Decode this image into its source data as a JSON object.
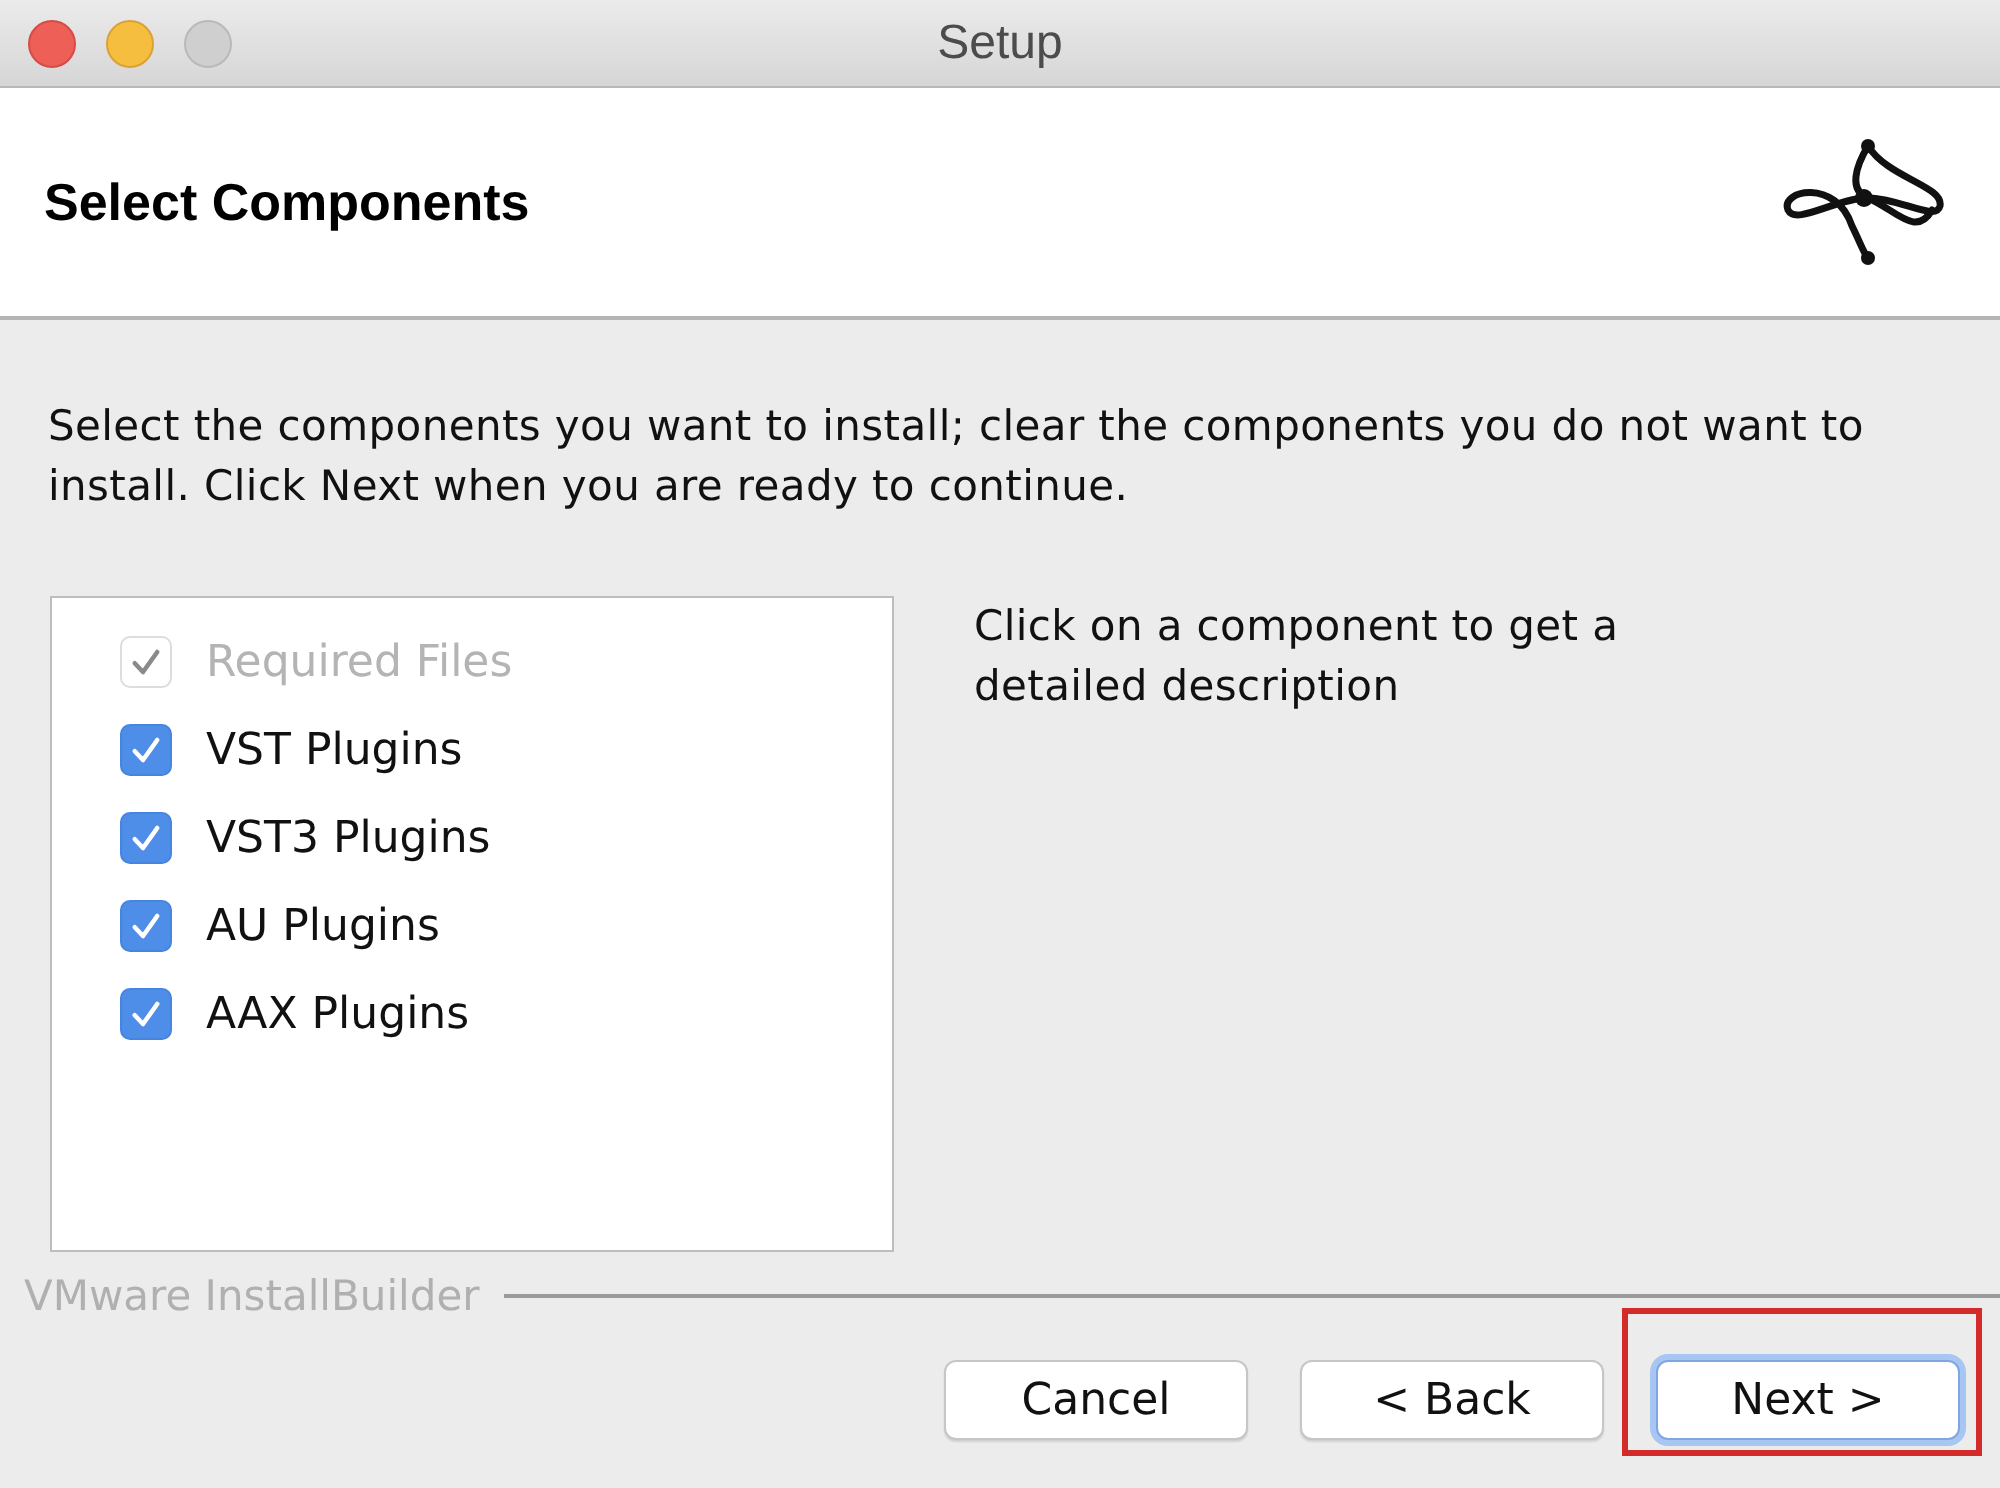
{
  "window": {
    "title": "Setup"
  },
  "header": {
    "title": "Select Components"
  },
  "instructions": "Select the components you want to install; clear the components you do not want to install. Click Next when you are ready to continue.",
  "components": [
    {
      "label": "Required Files",
      "checked": true,
      "disabled": true
    },
    {
      "label": "VST Plugins",
      "checked": true,
      "disabled": false
    },
    {
      "label": "VST3 Plugins",
      "checked": true,
      "disabled": false
    },
    {
      "label": "AU Plugins",
      "checked": true,
      "disabled": false
    },
    {
      "label": "AAX Plugins",
      "checked": true,
      "disabled": false
    }
  ],
  "description": "Click on a component to get a detailed description",
  "branding": "VMware InstallBuilder",
  "buttons": [
    {
      "label": "Cancel",
      "default": false,
      "highlighted": false
    },
    {
      "label": "< Back",
      "default": false,
      "highlighted": false
    },
    {
      "label": "Next >",
      "default": true,
      "highlighted": true
    }
  ]
}
